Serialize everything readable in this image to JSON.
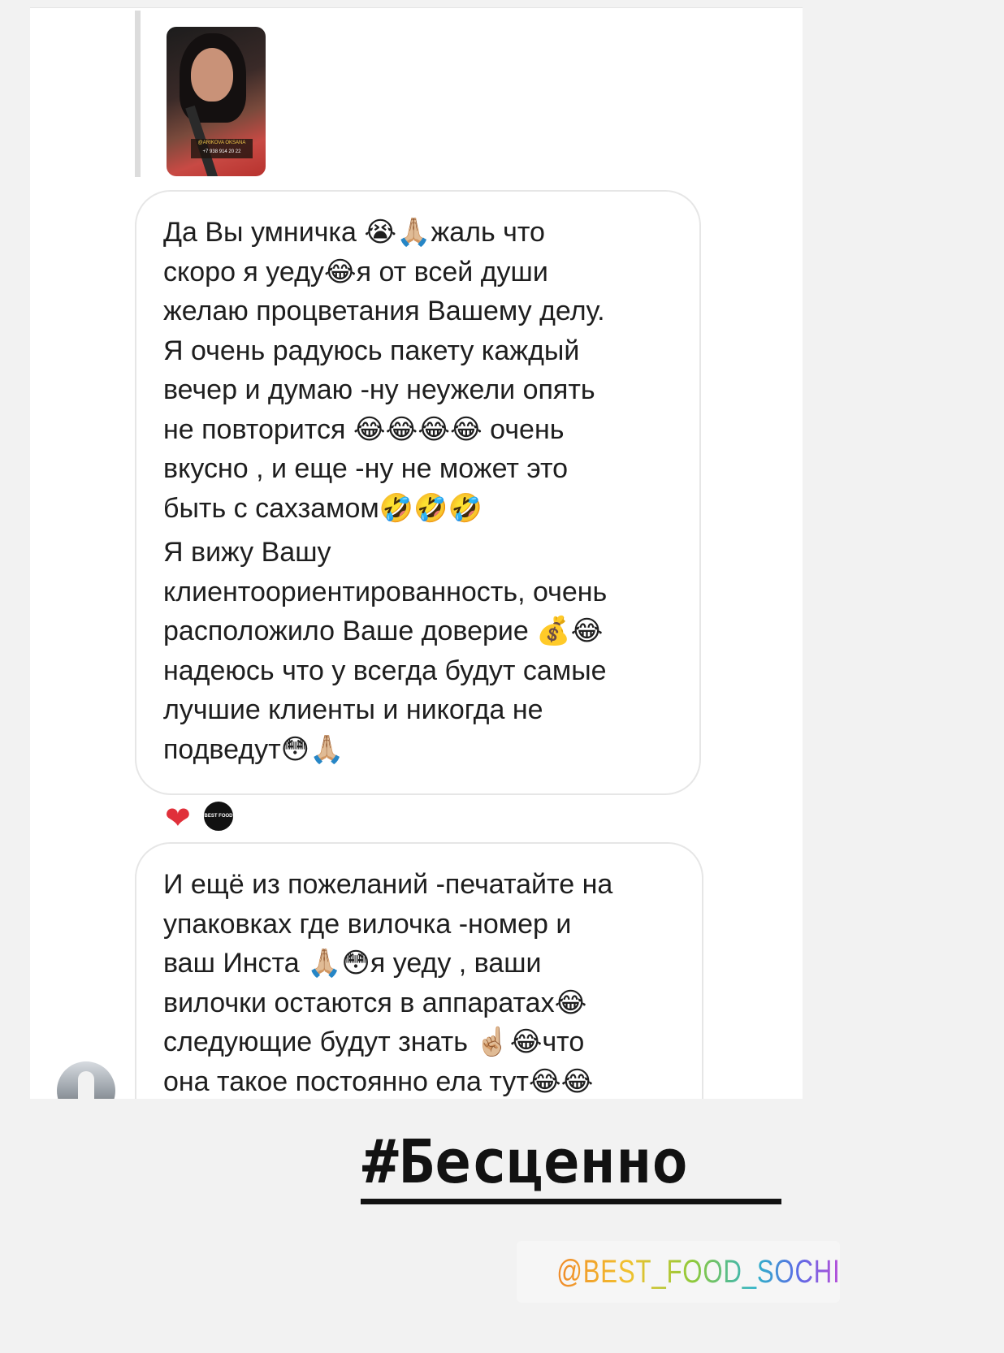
{
  "conversation": {
    "story_thumbnail": {
      "caption_line_1": "@ARIKOVA OKSANA",
      "caption_line_2": "+7 938 914 20 22"
    },
    "message_1": {
      "lines": [
        "Да Вы умничка 😭🙏🏼жаль что",
        "скоро я уеду😂я от всей души",
        "желаю процветания Вашему делу.",
        "Я очень радуюсь пакету каждый",
        "вечер и думаю -ну неужели опять",
        "не повторится 😂😂😂😂 очень",
        "вкусно , и еще -ну не может это",
        "быть с сахзамом🤣🤣🤣",
        "Я вижу Вашу",
        "клиентоориентированность, очень",
        "расположило Ваше доверие 💰😂",
        "надеюсь что у всегда будут самые",
        "лучшие клиенты и никогда не",
        "подведут😳🙏🏼"
      ]
    },
    "reactions": {
      "heart": "❤",
      "brand_avatar_text": "BEST FOOD"
    },
    "message_2": {
      "lines": [
        "И ещё из пожеланий -печатайте на",
        "упаковках где вилочка -номер и",
        "ваш Инста 🙏🏼😳я уеду , ваши",
        "вилочки остаются  в аппаратах😂",
        "следующие будут знать ☝🏼😂что",
        "она такое постоянно ела тут😂😂"
      ]
    }
  },
  "overlay": {
    "hashtag": "#Бесценно",
    "mention": "@BEST_FOOD_SOCHI"
  },
  "colors": {
    "heart": "#e0303a",
    "bubble_border": "#e6e6e6",
    "text": "#1e1e1e"
  }
}
